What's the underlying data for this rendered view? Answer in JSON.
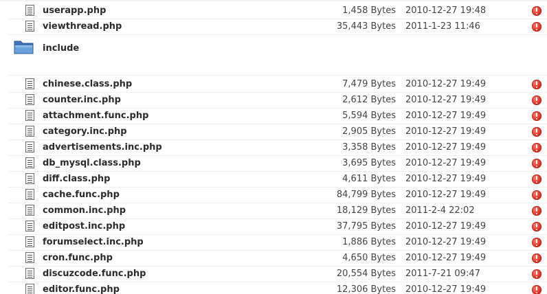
{
  "top_files": [
    {
      "name": "userapp.php",
      "size": "1,458 Bytes",
      "date": "2010-12-27 19:48"
    },
    {
      "name": "viewthread.php",
      "size": "35,443 Bytes",
      "date": "2011-1-23 11:46"
    }
  ],
  "folder": {
    "name": "include"
  },
  "include_files": [
    {
      "name": "chinese.class.php",
      "size": "7,479 Bytes",
      "date": "2010-12-27 19:49"
    },
    {
      "name": "counter.inc.php",
      "size": "2,612 Bytes",
      "date": "2010-12-27 19:49"
    },
    {
      "name": "attachment.func.php",
      "size": "5,594 Bytes",
      "date": "2010-12-27 19:49"
    },
    {
      "name": "category.inc.php",
      "size": "2,905 Bytes",
      "date": "2010-12-27 19:49"
    },
    {
      "name": "advertisements.inc.php",
      "size": "3,358 Bytes",
      "date": "2010-12-27 19:49"
    },
    {
      "name": "db_mysql.class.php",
      "size": "3,695 Bytes",
      "date": "2010-12-27 19:49"
    },
    {
      "name": "diff.class.php",
      "size": "4,611 Bytes",
      "date": "2010-12-27 19:49"
    },
    {
      "name": "cache.func.php",
      "size": "84,799 Bytes",
      "date": "2010-12-27 19:49"
    },
    {
      "name": "common.inc.php",
      "size": "18,129 Bytes",
      "date": "2011-2-4 22:02"
    },
    {
      "name": "editpost.inc.php",
      "size": "37,795 Bytes",
      "date": "2010-12-27 19:49"
    },
    {
      "name": "forumselect.inc.php",
      "size": "1,886 Bytes",
      "date": "2010-12-27 19:49"
    },
    {
      "name": "cron.func.php",
      "size": "4,650 Bytes",
      "date": "2010-12-27 19:49"
    },
    {
      "name": "discuzcode.func.php",
      "size": "20,554 Bytes",
      "date": "2011-7-21 09:47"
    },
    {
      "name": "editor.func.php",
      "size": "12,306 Bytes",
      "date": "2010-12-27 19:49"
    }
  ],
  "icons": {
    "file": "document-icon",
    "folder": "folder-icon",
    "status": "warning-icon"
  },
  "colors": {
    "warning": "#d8261b",
    "folder": "#4f86c6",
    "row_divider": "#eef0f2"
  }
}
